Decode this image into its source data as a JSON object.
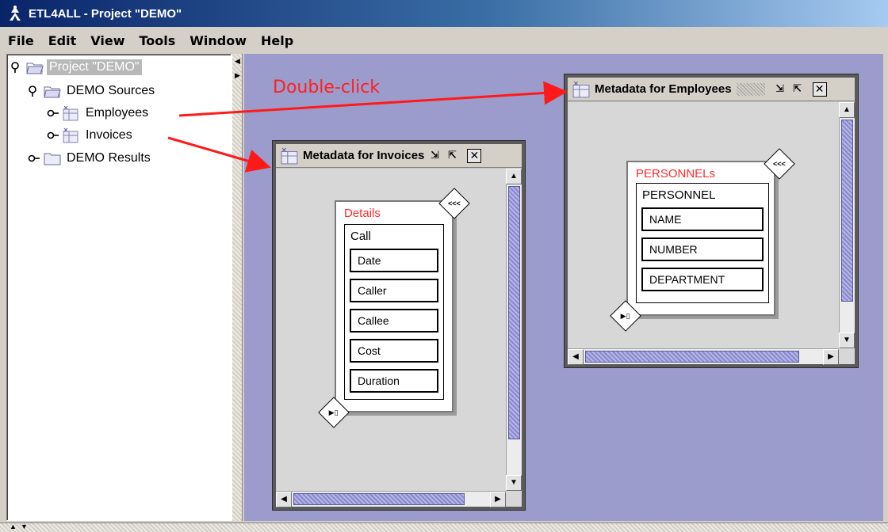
{
  "window": {
    "title": "ETL4ALL - Project \"DEMO\""
  },
  "menu": [
    "File",
    "Edit",
    "View",
    "Tools",
    "Window",
    "Help"
  ],
  "tree": {
    "project": "Project \"DEMO\"",
    "sources": "DEMO Sources",
    "employees": "Employees",
    "invoices": "Invoices",
    "results": "DEMO Results"
  },
  "instruction": "Double-click",
  "invoices_frame": {
    "title": "Metadata for Invoices",
    "entity_title": "Details",
    "record": "Call",
    "fields": [
      "Date",
      "Caller",
      "Callee",
      "Cost",
      "Duration"
    ]
  },
  "employees_frame": {
    "title": "Metadata for Employees",
    "entity_title": "PERSONNELs",
    "record": "PERSONNEL",
    "fields": [
      "NAME",
      "NUMBER",
      "DEPARTMENT"
    ]
  },
  "colors": {
    "accent_red": "#ff2020",
    "desktop": "#9c9ccc",
    "titlebar": "#0a246a"
  }
}
